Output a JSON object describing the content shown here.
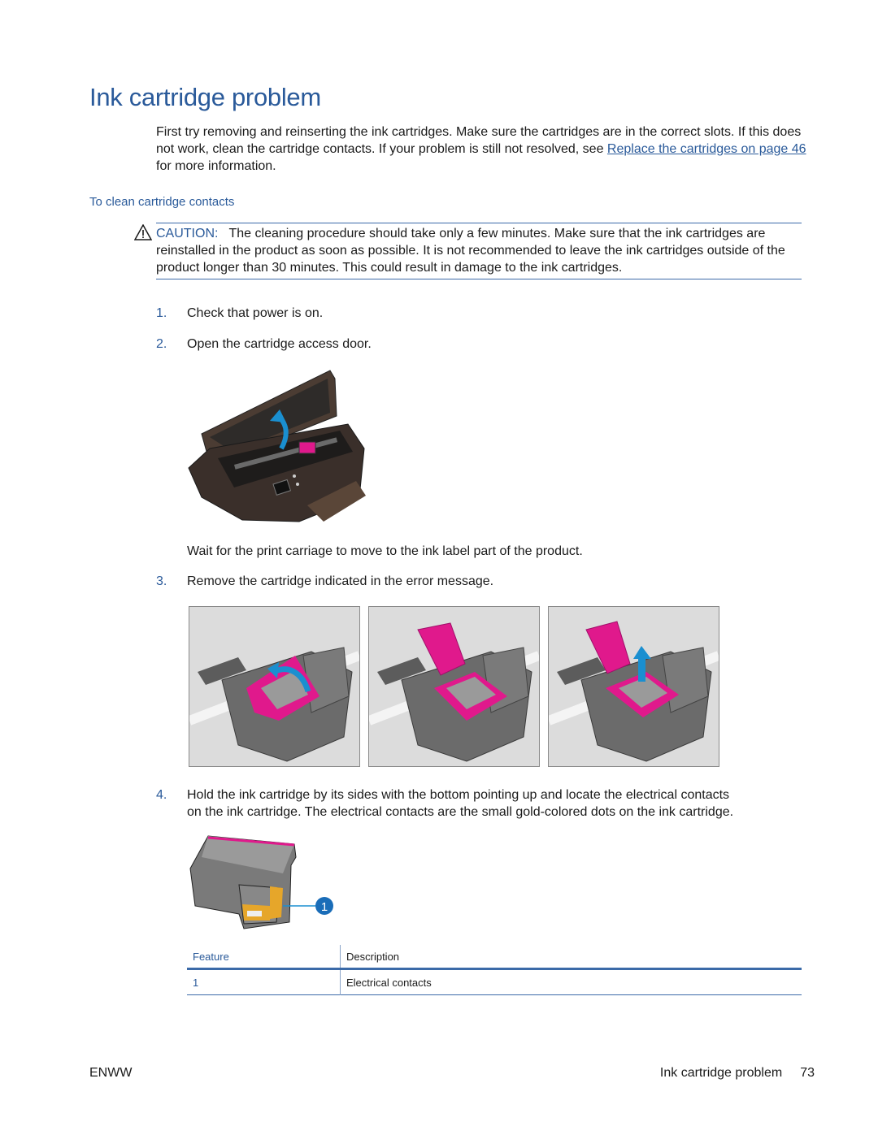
{
  "page": {
    "title": "Ink cartridge problem",
    "intro": {
      "text_before_link": "First try removing and reinserting the ink cartridges. Make sure the cartridges are in the correct slots. If this does not work, clean the cartridge contacts. If your problem is still not resolved, see ",
      "link_text": "Replace the cartridges on page 46",
      "text_after_link": " for more information."
    },
    "subheading": "To clean cartridge contacts",
    "caution": {
      "icon": "warning-triangle-icon",
      "label": "CAUTION:",
      "text": "The cleaning procedure should take only a few minutes. Make sure that the ink cartridges are reinstalled in the product as soon as possible. It is not recommended to leave the ink cartridges outside of the product longer than 30 minutes. This could result in damage to the ink cartridges."
    },
    "steps": [
      {
        "number": "1.",
        "text": "Check that power is on."
      },
      {
        "number": "2.",
        "text": "Open the cartridge access door."
      },
      {
        "number": "",
        "text": "Wait for the print carriage to move to the ink label part of the product."
      },
      {
        "number": "3.",
        "text": "Remove the cartridge indicated in the error message."
      },
      {
        "number": "4.",
        "text_line1": "Hold the ink cartridge by its sides with the bottom pointing up and locate the electrical contacts",
        "text_line2": "on the ink cartridge. The electrical contacts are the small gold-colored dots on the ink cartridge."
      }
    ],
    "figures": {
      "printer": "printer-open-access-door-illustration",
      "removal_steps": [
        "open-cartridge-latch",
        "latch-opened",
        "lift-cartridge-out"
      ],
      "cartridge_callout": "1"
    },
    "colors": {
      "accent": "#2a5a9a",
      "magenta": "#e0198c",
      "arrow_blue": "#1a8fd0"
    },
    "table": {
      "headers": [
        "Feature",
        "Description"
      ],
      "rows": [
        {
          "feature": "1",
          "description": "Electrical contacts"
        }
      ]
    },
    "footer": {
      "left": "ENWW",
      "section": "Ink cartridge problem",
      "page_number": "73"
    }
  }
}
